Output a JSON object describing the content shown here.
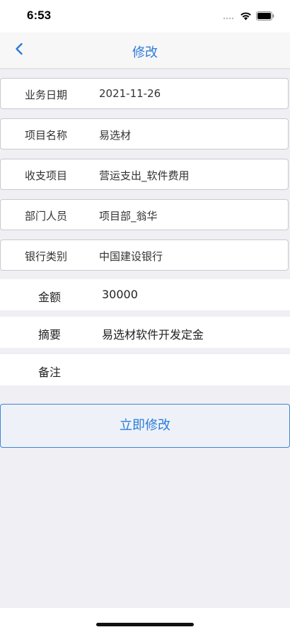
{
  "status_bar": {
    "time": "6:53"
  },
  "nav": {
    "title": "修改"
  },
  "fields": [
    {
      "label": "业务日期",
      "value": "2021-11-26"
    },
    {
      "label": "项目名称",
      "value": "易选材"
    },
    {
      "label": "收支项目",
      "value": "营运支出_软件费用"
    },
    {
      "label": "部门人员",
      "value": "项目部_翁华"
    },
    {
      "label": "银行类别",
      "value": "中国建设银行"
    }
  ],
  "inputs": {
    "amount_label": "金额",
    "amount_value": "30000",
    "summary_label": "摘要",
    "summary_value": "易选材软件开发定金",
    "remark_label": "备注",
    "remark_value": ""
  },
  "submit_label": "立即修改",
  "colors": {
    "accent": "#2b7bd8",
    "background": "#efeff4"
  }
}
